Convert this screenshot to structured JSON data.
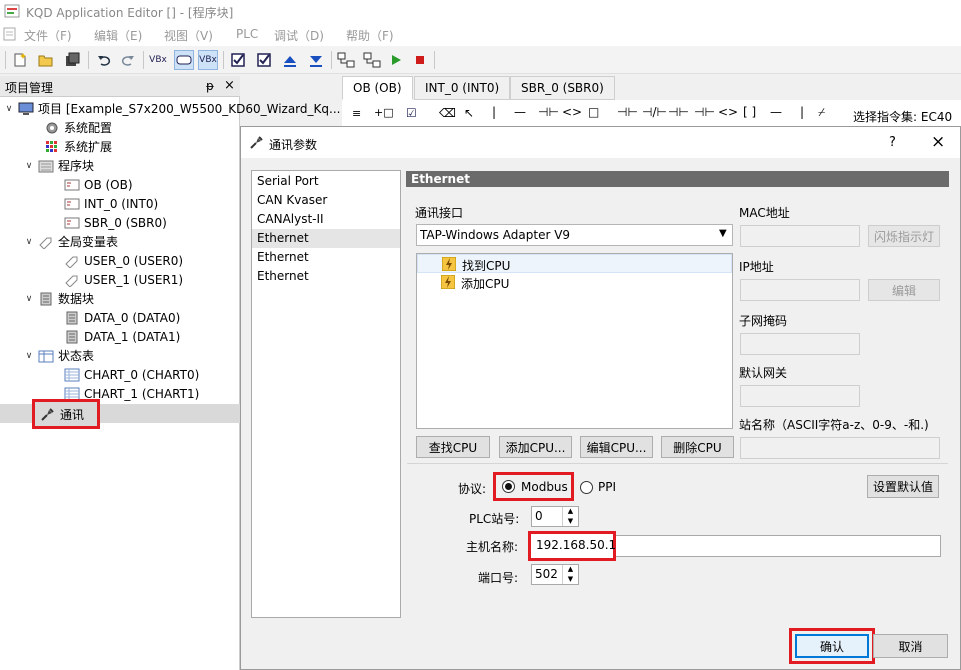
{
  "window": {
    "title": "KQD Application Editor [] - [程序块]"
  },
  "menu": [
    "文件（F)",
    "编辑（E)",
    "视图（V)",
    "PLC",
    "调试（D)",
    "帮助（F)"
  ],
  "project_panel": {
    "title": "项目管理",
    "pin": "ᵽ",
    "close": "×",
    "tree": [
      {
        "label": "项目 [Example_S7x200_W5500_KD60_Wizard_Kq...",
        "level": 0,
        "arrow": "∨",
        "icon": "computer-icon"
      },
      {
        "label": "系统配置",
        "level": 1,
        "icon": "gear-icon"
      },
      {
        "label": "系统扩展",
        "level": 1,
        "icon": "grid-icon"
      },
      {
        "label": "程序块",
        "level": 1,
        "arrow": "∨",
        "icon": "folder-icon"
      },
      {
        "label": "OB (OB)",
        "level": 2,
        "icon": "program-block-icon"
      },
      {
        "label": "INT_0 (INT0)",
        "level": 2,
        "icon": "program-block-icon"
      },
      {
        "label": "SBR_0 (SBR0)",
        "level": 2,
        "icon": "program-block-icon"
      },
      {
        "label": "全局变量表",
        "level": 1,
        "arrow": "∨",
        "icon": "tag-icon"
      },
      {
        "label": "USER_0 (USER0)",
        "level": 2,
        "icon": "tag-icon"
      },
      {
        "label": "USER_1 (USER1)",
        "level": 2,
        "icon": "tag-icon"
      },
      {
        "label": "数据块",
        "level": 1,
        "arrow": "∨",
        "icon": "data-block-icon"
      },
      {
        "label": "DATA_0 (DATA0)",
        "level": 2,
        "icon": "data-block-icon"
      },
      {
        "label": "DATA_1 (DATA1)",
        "level": 2,
        "icon": "data-block-icon"
      },
      {
        "label": "状态表",
        "level": 1,
        "arrow": "∨",
        "icon": "status-table-icon"
      },
      {
        "label": "CHART_0 (CHART0)",
        "level": 2,
        "icon": "chart-icon"
      },
      {
        "label": "CHART_1 (CHART1)",
        "level": 2,
        "icon": "chart-icon"
      },
      {
        "label": "通讯",
        "level": 1,
        "icon": "communication-icon",
        "selected": true
      }
    ]
  },
  "editor": {
    "tabs": [
      "OB (OB)",
      "INT_0 (INT0)",
      "SBR_0 (SBR0)"
    ],
    "instruction_set_label": "选择指令集: EC40"
  },
  "dialog": {
    "title": "通讯参数",
    "help": "?",
    "close": "×",
    "device_list": [
      "Serial Port",
      "CAN Kvaser",
      "CANAlyst-II",
      "Ethernet",
      "Ethernet",
      "Ethernet"
    ],
    "selected_device_index": 3,
    "section_title": "Ethernet",
    "interface_label": "通讯接口",
    "interface_value": "TAP-Windows Adapter V9",
    "cpu_list": [
      "找到CPU",
      "添加CPU"
    ],
    "mac_label": "MAC地址",
    "blink_button": "闪烁指示灯",
    "ip_label": "IP地址",
    "edit_button": "编辑",
    "subnet_label": "子网掩码",
    "gateway_label": "默认网关",
    "station_name_label": "站名称（ASCII字符a-z、0-9、-和.)",
    "buttons": {
      "find_cpu": "查找CPU",
      "add_cpu": "添加CPU...",
      "edit_cpu": "编辑CPU...",
      "delete_cpu": "删除CPU"
    },
    "protocol_label": "协议:",
    "protocol_options": [
      "Modbus",
      "PPI"
    ],
    "protocol_selected": "Modbus",
    "set_default_button": "设置默认值",
    "plc_station_label": "PLC站号:",
    "plc_station_value": "0",
    "host_label": "主机名称:",
    "host_value": "192.168.50.1",
    "port_label": "端口号:",
    "port_value": "502",
    "ok_button": "确认",
    "cancel_button": "取消"
  }
}
